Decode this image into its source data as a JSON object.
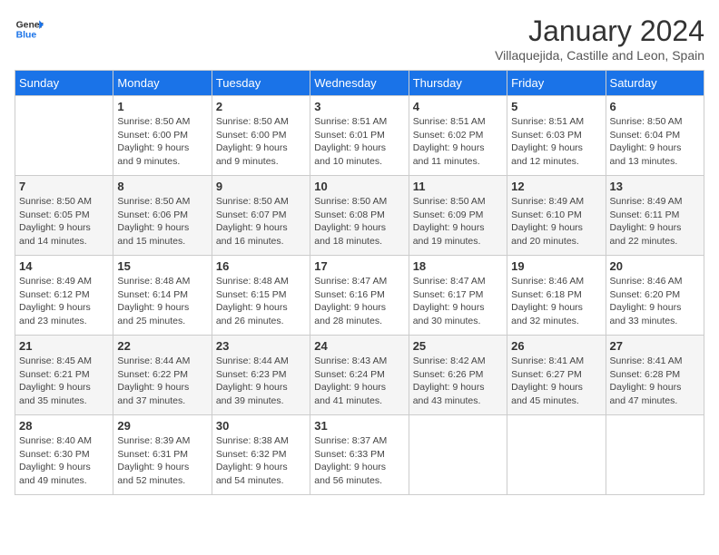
{
  "logo": {
    "line1": "General",
    "line2": "Blue"
  },
  "title": "January 2024",
  "subtitle": "Villaquejida, Castille and Leon, Spain",
  "days_of_week": [
    "Sunday",
    "Monday",
    "Tuesday",
    "Wednesday",
    "Thursday",
    "Friday",
    "Saturday"
  ],
  "weeks": [
    [
      {
        "day": "",
        "sunrise": "",
        "sunset": "",
        "daylight": ""
      },
      {
        "day": "1",
        "sunrise": "Sunrise: 8:50 AM",
        "sunset": "Sunset: 6:00 PM",
        "daylight": "Daylight: 9 hours and 9 minutes."
      },
      {
        "day": "2",
        "sunrise": "Sunrise: 8:50 AM",
        "sunset": "Sunset: 6:00 PM",
        "daylight": "Daylight: 9 hours and 9 minutes."
      },
      {
        "day": "3",
        "sunrise": "Sunrise: 8:51 AM",
        "sunset": "Sunset: 6:01 PM",
        "daylight": "Daylight: 9 hours and 10 minutes."
      },
      {
        "day": "4",
        "sunrise": "Sunrise: 8:51 AM",
        "sunset": "Sunset: 6:02 PM",
        "daylight": "Daylight: 9 hours and 11 minutes."
      },
      {
        "day": "5",
        "sunrise": "Sunrise: 8:51 AM",
        "sunset": "Sunset: 6:03 PM",
        "daylight": "Daylight: 9 hours and 12 minutes."
      },
      {
        "day": "6",
        "sunrise": "Sunrise: 8:50 AM",
        "sunset": "Sunset: 6:04 PM",
        "daylight": "Daylight: 9 hours and 13 minutes."
      }
    ],
    [
      {
        "day": "7",
        "sunrise": "Sunrise: 8:50 AM",
        "sunset": "Sunset: 6:05 PM",
        "daylight": "Daylight: 9 hours and 14 minutes."
      },
      {
        "day": "8",
        "sunrise": "Sunrise: 8:50 AM",
        "sunset": "Sunset: 6:06 PM",
        "daylight": "Daylight: 9 hours and 15 minutes."
      },
      {
        "day": "9",
        "sunrise": "Sunrise: 8:50 AM",
        "sunset": "Sunset: 6:07 PM",
        "daylight": "Daylight: 9 hours and 16 minutes."
      },
      {
        "day": "10",
        "sunrise": "Sunrise: 8:50 AM",
        "sunset": "Sunset: 6:08 PM",
        "daylight": "Daylight: 9 hours and 18 minutes."
      },
      {
        "day": "11",
        "sunrise": "Sunrise: 8:50 AM",
        "sunset": "Sunset: 6:09 PM",
        "daylight": "Daylight: 9 hours and 19 minutes."
      },
      {
        "day": "12",
        "sunrise": "Sunrise: 8:49 AM",
        "sunset": "Sunset: 6:10 PM",
        "daylight": "Daylight: 9 hours and 20 minutes."
      },
      {
        "day": "13",
        "sunrise": "Sunrise: 8:49 AM",
        "sunset": "Sunset: 6:11 PM",
        "daylight": "Daylight: 9 hours and 22 minutes."
      }
    ],
    [
      {
        "day": "14",
        "sunrise": "Sunrise: 8:49 AM",
        "sunset": "Sunset: 6:12 PM",
        "daylight": "Daylight: 9 hours and 23 minutes."
      },
      {
        "day": "15",
        "sunrise": "Sunrise: 8:48 AM",
        "sunset": "Sunset: 6:14 PM",
        "daylight": "Daylight: 9 hours and 25 minutes."
      },
      {
        "day": "16",
        "sunrise": "Sunrise: 8:48 AM",
        "sunset": "Sunset: 6:15 PM",
        "daylight": "Daylight: 9 hours and 26 minutes."
      },
      {
        "day": "17",
        "sunrise": "Sunrise: 8:47 AM",
        "sunset": "Sunset: 6:16 PM",
        "daylight": "Daylight: 9 hours and 28 minutes."
      },
      {
        "day": "18",
        "sunrise": "Sunrise: 8:47 AM",
        "sunset": "Sunset: 6:17 PM",
        "daylight": "Daylight: 9 hours and 30 minutes."
      },
      {
        "day": "19",
        "sunrise": "Sunrise: 8:46 AM",
        "sunset": "Sunset: 6:18 PM",
        "daylight": "Daylight: 9 hours and 32 minutes."
      },
      {
        "day": "20",
        "sunrise": "Sunrise: 8:46 AM",
        "sunset": "Sunset: 6:20 PM",
        "daylight": "Daylight: 9 hours and 33 minutes."
      }
    ],
    [
      {
        "day": "21",
        "sunrise": "Sunrise: 8:45 AM",
        "sunset": "Sunset: 6:21 PM",
        "daylight": "Daylight: 9 hours and 35 minutes."
      },
      {
        "day": "22",
        "sunrise": "Sunrise: 8:44 AM",
        "sunset": "Sunset: 6:22 PM",
        "daylight": "Daylight: 9 hours and 37 minutes."
      },
      {
        "day": "23",
        "sunrise": "Sunrise: 8:44 AM",
        "sunset": "Sunset: 6:23 PM",
        "daylight": "Daylight: 9 hours and 39 minutes."
      },
      {
        "day": "24",
        "sunrise": "Sunrise: 8:43 AM",
        "sunset": "Sunset: 6:24 PM",
        "daylight": "Daylight: 9 hours and 41 minutes."
      },
      {
        "day": "25",
        "sunrise": "Sunrise: 8:42 AM",
        "sunset": "Sunset: 6:26 PM",
        "daylight": "Daylight: 9 hours and 43 minutes."
      },
      {
        "day": "26",
        "sunrise": "Sunrise: 8:41 AM",
        "sunset": "Sunset: 6:27 PM",
        "daylight": "Daylight: 9 hours and 45 minutes."
      },
      {
        "day": "27",
        "sunrise": "Sunrise: 8:41 AM",
        "sunset": "Sunset: 6:28 PM",
        "daylight": "Daylight: 9 hours and 47 minutes."
      }
    ],
    [
      {
        "day": "28",
        "sunrise": "Sunrise: 8:40 AM",
        "sunset": "Sunset: 6:30 PM",
        "daylight": "Daylight: 9 hours and 49 minutes."
      },
      {
        "day": "29",
        "sunrise": "Sunrise: 8:39 AM",
        "sunset": "Sunset: 6:31 PM",
        "daylight": "Daylight: 9 hours and 52 minutes."
      },
      {
        "day": "30",
        "sunrise": "Sunrise: 8:38 AM",
        "sunset": "Sunset: 6:32 PM",
        "daylight": "Daylight: 9 hours and 54 minutes."
      },
      {
        "day": "31",
        "sunrise": "Sunrise: 8:37 AM",
        "sunset": "Sunset: 6:33 PM",
        "daylight": "Daylight: 9 hours and 56 minutes."
      },
      {
        "day": "",
        "sunrise": "",
        "sunset": "",
        "daylight": ""
      },
      {
        "day": "",
        "sunrise": "",
        "sunset": "",
        "daylight": ""
      },
      {
        "day": "",
        "sunrise": "",
        "sunset": "",
        "daylight": ""
      }
    ]
  ]
}
